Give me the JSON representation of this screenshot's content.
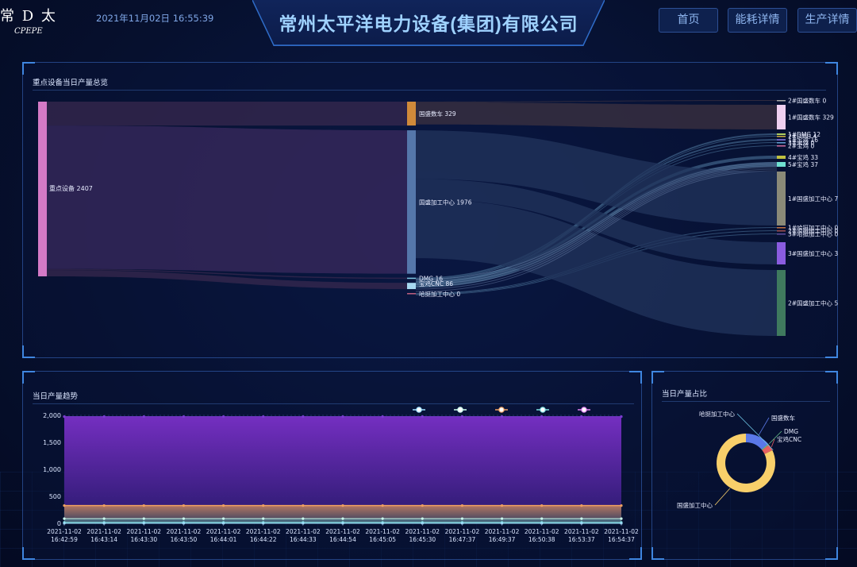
{
  "header": {
    "logo_text": "常 D 太",
    "logo_en": "CPEPE",
    "datetime": "2021年11月02日 16:55:39",
    "company_title": "常州太平洋电力设备(集团)有限公司",
    "nav": [
      {
        "label": "首页"
      },
      {
        "label": "能耗详情"
      },
      {
        "label": "生产详情"
      }
    ]
  },
  "sankey_panel": {
    "title": "重点设备当日产量总览",
    "root": {
      "label": "重点设备 2407",
      "name": "重点设备",
      "value": 2407
    },
    "middle": [
      {
        "label": "国盛数车 329",
        "name": "国盛数车",
        "value": 329,
        "color": "#d08a3a"
      },
      {
        "label": "国盛加工中心 1976",
        "name": "国盛加工中心",
        "value": 1976,
        "color": "#5577aa"
      },
      {
        "label": "DMG 16",
        "name": "DMG",
        "value": 16,
        "color": "#7ec8e3"
      },
      {
        "label": "宝鸡CNC 86",
        "name": "宝鸡CNC",
        "value": 86,
        "color": "#a7d8f0"
      },
      {
        "label": "哈挺加工中心 0",
        "name": "哈挺加工中心",
        "value": 0,
        "color": "#c06080"
      }
    ],
    "leaves": [
      {
        "label": "2#国盛数车 0",
        "color": "#aaaaaa"
      },
      {
        "label": "1#国盛数车 329",
        "color": "#f0d0f0"
      },
      {
        "label": "1#DMG 12",
        "color": "#b0d060"
      },
      {
        "label": "2#DMG 4",
        "color": "#d0b040"
      },
      {
        "label": "1#宝鸡 16",
        "color": "#7060c0"
      },
      {
        "label": "3#宝鸡 0",
        "color": "#60a0d0"
      },
      {
        "label": "2#宝鸡 0",
        "color": "#d070a0"
      },
      {
        "label": "4#宝鸡 33",
        "color": "#c0c040"
      },
      {
        "label": "5#宝鸡 37",
        "color": "#70e0d0"
      },
      {
        "label": "1#国盛加工中心 7",
        "color": "#8a8a78"
      },
      {
        "label": "1#哈挺加工中心 0",
        "color": "#c07040"
      },
      {
        "label": "2#哈挺加工中心 0",
        "color": "#a05050"
      },
      {
        "label": "3#哈挺加工中心 0",
        "color": "#6050a0"
      },
      {
        "label": "3#国盛加工中心 3",
        "color": "#8a5ce0"
      },
      {
        "label": "2#国盛加工中心 5",
        "color": "#3f7a5e"
      }
    ]
  },
  "trend_panel": {
    "title": "当日产量趋势",
    "legend": [
      {
        "name": "",
        "color": "#9fe0ff"
      },
      {
        "name": "",
        "color": "#ccffee"
      },
      {
        "name": "",
        "color": "#f0a060"
      },
      {
        "name": "",
        "color": "#7ee0e0"
      },
      {
        "name": "",
        "color": "#e080f0"
      }
    ],
    "y_ticks": [
      "2,000",
      "1,500",
      "1,000",
      "500",
      "0"
    ],
    "x_ticks": [
      [
        "2021-11-02",
        "16:42:59"
      ],
      [
        "2021-11-02",
        "16:43:14"
      ],
      [
        "2021-11-02",
        "16:43:30"
      ],
      [
        "2021-11-02",
        "16:43:50"
      ],
      [
        "2021-11-02",
        "16:44:01"
      ],
      [
        "2021-11-02",
        "16:44:22"
      ],
      [
        "2021-11-02",
        "16:44:33"
      ],
      [
        "2021-11-02",
        "16:44:54"
      ],
      [
        "2021-11-02",
        "16:45:05"
      ],
      [
        "2021-11-02",
        "16:45:30"
      ],
      [
        "2021-11-02",
        "16:47:37"
      ],
      [
        "2021-11-02",
        "16:49:37"
      ],
      [
        "2021-11-02",
        "16:50:38"
      ],
      [
        "2021-11-02",
        "16:53:37"
      ],
      [
        "2021-11-02",
        "16:54:37"
      ]
    ]
  },
  "pie_panel": {
    "title": "当日产量占比",
    "slices": [
      {
        "name": "国盛数车",
        "value": 329,
        "color": "#5a78e8"
      },
      {
        "name": "DMG",
        "value": 16,
        "color": "#66c08a"
      },
      {
        "name": "宝鸡CNC",
        "value": 86,
        "color": "#e66060"
      },
      {
        "name": "哈挺加工中心",
        "value": 0,
        "color": "#6fc8e8"
      },
      {
        "name": "国盛加工中心",
        "value": 1976,
        "color": "#f8cf6a"
      }
    ]
  },
  "chart_data": [
    {
      "type": "sankey",
      "title": "重点设备当日产量总览",
      "links": [
        {
          "source": "重点设备",
          "target": "国盛数车",
          "value": 329
        },
        {
          "source": "重点设备",
          "target": "国盛加工中心",
          "value": 1976
        },
        {
          "source": "重点设备",
          "target": "DMG",
          "value": 16
        },
        {
          "source": "重点设备",
          "target": "宝鸡CNC",
          "value": 86
        },
        {
          "source": "重点设备",
          "target": "哈挺加工中心",
          "value": 0
        }
      ]
    },
    {
      "type": "area",
      "title": "当日产量趋势",
      "x": [
        "16:42:59",
        "16:43:14",
        "16:43:30",
        "16:43:50",
        "16:44:01",
        "16:44:22",
        "16:44:33",
        "16:44:54",
        "16:45:05",
        "16:45:30",
        "16:47:37",
        "16:49:37",
        "16:50:38",
        "16:53:37",
        "16:54:37"
      ],
      "ylim": [
        0,
        2000
      ],
      "series": [
        {
          "values": [
            1976,
            1976,
            1976,
            1976,
            1976,
            1976,
            1976,
            1976,
            1976,
            1976,
            1976,
            1976,
            1976,
            1976,
            1976
          ],
          "color": "#7a3bd0"
        },
        {
          "values": [
            329,
            329,
            329,
            329,
            329,
            329,
            329,
            329,
            329,
            329,
            329,
            329,
            329,
            329,
            329
          ],
          "color": "#f0a060"
        },
        {
          "values": [
            86,
            86,
            86,
            86,
            86,
            86,
            86,
            86,
            86,
            86,
            86,
            86,
            86,
            86,
            86
          ],
          "color": "#ccffee"
        },
        {
          "values": [
            16,
            16,
            16,
            16,
            16,
            16,
            16,
            16,
            16,
            16,
            16,
            16,
            16,
            16,
            16
          ],
          "color": "#7ee0e0"
        },
        {
          "values": [
            0,
            0,
            0,
            0,
            0,
            0,
            0,
            0,
            0,
            0,
            0,
            0,
            0,
            0,
            0
          ],
          "color": "#9fe0ff"
        }
      ]
    },
    {
      "type": "pie",
      "title": "当日产量占比",
      "labels": [
        "国盛数车",
        "DMG",
        "宝鸡CNC",
        "哈挺加工中心",
        "国盛加工中心"
      ],
      "values": [
        329,
        16,
        86,
        0,
        1976
      ]
    }
  ]
}
